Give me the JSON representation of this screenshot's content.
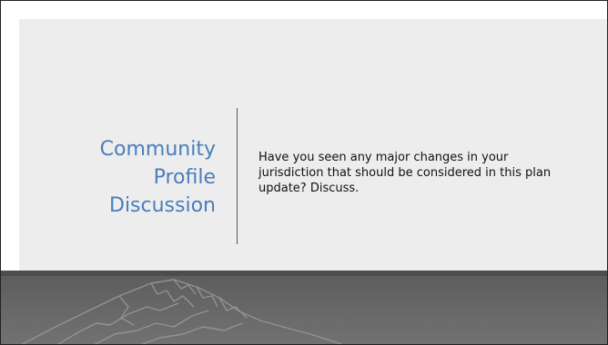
{
  "slide": {
    "title": "Community\nProfile\nDiscussion",
    "body": "Have you seen any major changes in your jurisdiction that should be considered in this plan update? Discuss."
  },
  "footer": {
    "image": "mountain-watermark-icon"
  },
  "colors": {
    "title": "#4a7ebb",
    "panel": "#ededed",
    "footer": "#5c5c5c"
  }
}
